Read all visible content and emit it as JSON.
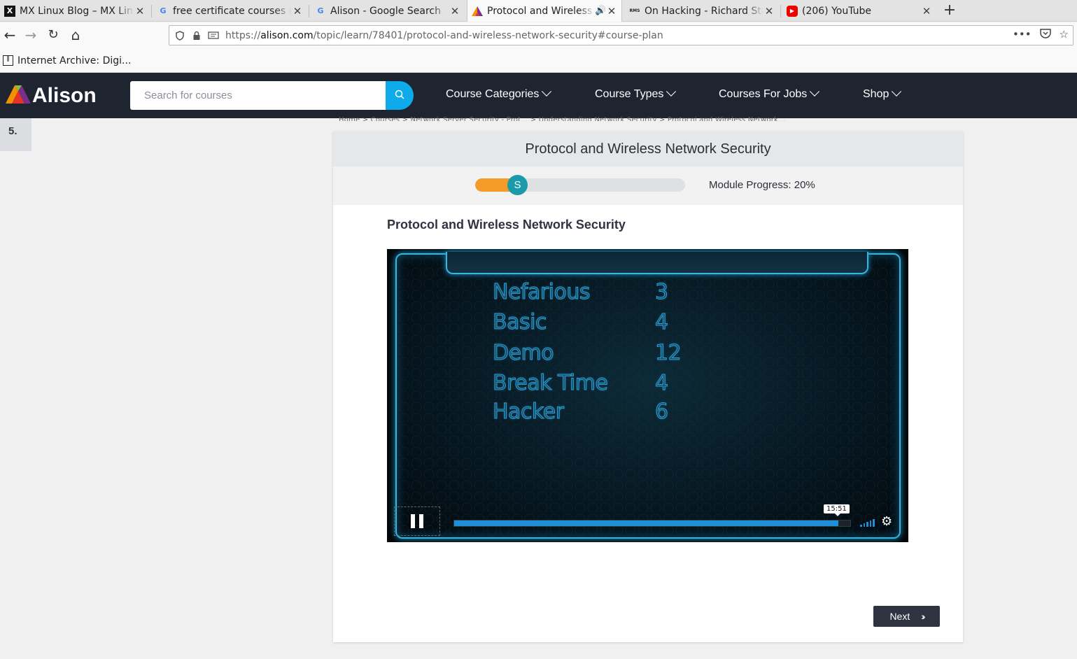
{
  "browser": {
    "tabs": [
      {
        "title": "MX Linux Blog – MX Linux",
        "favicon": "X",
        "favicon_color": "#111"
      },
      {
        "title": "free certificate courses o",
        "favicon": "G",
        "favicon_color": "#4285f4"
      },
      {
        "title": "Alison - Google Search",
        "favicon": "G",
        "favicon_color": "#4285f4"
      },
      {
        "title": "Protocol and Wireless",
        "favicon": "A",
        "favicon_color": "#e94e1b",
        "active": true,
        "audio": "🔊"
      },
      {
        "title": "On Hacking - Richard Sta",
        "favicon": "RMS",
        "favicon_color": "#111"
      },
      {
        "title": "(206) YouTube",
        "favicon": "▶",
        "favicon_color": "#e00"
      }
    ],
    "close_glyph": "✕",
    "new_tab": "+",
    "url_scheme": "https://",
    "url_host": "alison.com",
    "url_path": "/topic/learn/78401/protocol-and-wireless-network-security#course-plan",
    "bookmark": "Internet Archive: Digi..."
  },
  "site": {
    "brand": "Alison",
    "search_placeholder": "Search for courses",
    "menu": [
      "Course Categories",
      "Course Types",
      "Courses For Jobs",
      "Shop"
    ]
  },
  "left_rail": {
    "number": "5."
  },
  "breadcrumb": "Home  >  Courses  >  Network Server Security - Prot...  >  Understanding Network Security  >  Protocol and Wireless Network...",
  "card": {
    "header": "Protocol and Wireless Network Security",
    "progress_knob": "S",
    "progress_value": 0.2,
    "progress_label": "Module Progress: 20%",
    "section_title": "Protocol and Wireless Network Security"
  },
  "video": {
    "scores": [
      {
        "name": "Nefarious",
        "value": "3"
      },
      {
        "name": "Basic",
        "value": "4"
      },
      {
        "name": "Demo",
        "value": "12"
      },
      {
        "name": "Break Time",
        "value": "4"
      },
      {
        "name": "Hacker",
        "value": "6"
      }
    ],
    "time_tooltip": "15:51",
    "played_fraction": 0.97
  },
  "next_label": "Next",
  "colors": {
    "header_bg": "#1e2430",
    "accent": "#0eaaea",
    "progress_fill": "#f59b28",
    "knob": "#1b9aaa"
  }
}
